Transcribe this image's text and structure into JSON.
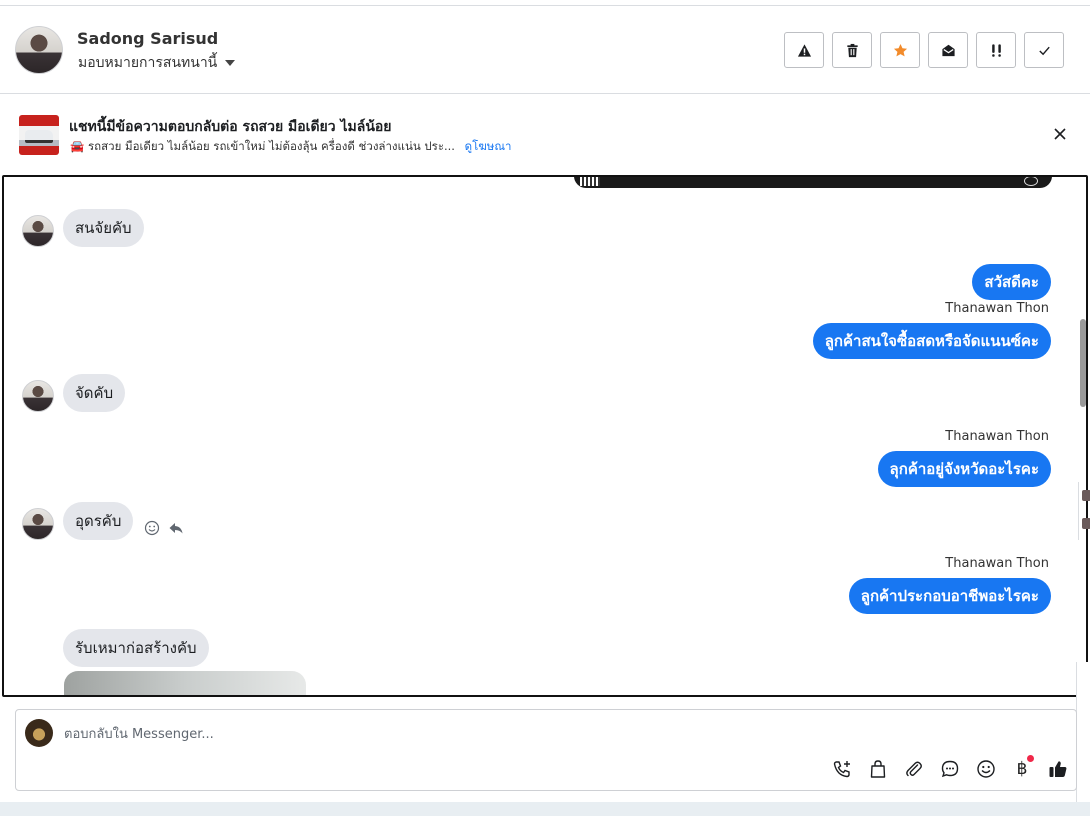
{
  "header": {
    "contact_name": "Sadong Sarisud",
    "assign_label": "มอบหมายการสนทนานี้",
    "actions": [
      {
        "name": "report-spam-button",
        "icon": "warning-icon"
      },
      {
        "name": "delete-button",
        "icon": "trash-icon"
      },
      {
        "name": "star-button",
        "icon": "star-icon",
        "color": "#f28b2b"
      },
      {
        "name": "mark-unread-button",
        "icon": "envelope-open-icon"
      },
      {
        "name": "follow-up-button",
        "icon": "double-exclamation-icon"
      },
      {
        "name": "mark-done-button",
        "icon": "check-icon"
      }
    ]
  },
  "ad_banner": {
    "title": "แชทนี้มีข้อความตอบกลับต่อ รถสวย มือเดียว ไมล์น้อย",
    "subtitle": "🚘 รถสวย มือเดียว ไมล์น้อย รถเข้าใหม่ ไม่ต้องลุ้น ครื่องดี ช่วงล่างแน่น ประ...",
    "link": "ดูโฆษณา"
  },
  "messages": [
    {
      "direction": "in",
      "text": "สนจัยคับ"
    },
    {
      "direction": "out",
      "text": "สวัสดีคะ"
    },
    {
      "direction": "out",
      "sender": "Thanawan Thon",
      "text": "ลูกค้าสนใจซื้อสดหรือจัดแนนซ์คะ"
    },
    {
      "direction": "in",
      "text": "จัดคับ"
    },
    {
      "direction": "out",
      "sender": "Thanawan Thon",
      "text": "ลุกค้าอยู่จังหวัดอะไรคะ"
    },
    {
      "direction": "in",
      "text": "อุดรคับ"
    },
    {
      "direction": "out",
      "sender": "Thanawan Thon",
      "text": "ลูกค้าประกอบอาชีพอะไรคะ"
    },
    {
      "direction": "in",
      "text": "รับเหมาก่อสร้างคับ"
    }
  ],
  "composer": {
    "placeholder": "ตอบกลับใน Messenger...",
    "tools": [
      "phone-add-icon",
      "shopping-bag-icon",
      "paperclip-icon",
      "chat-bubble-icon",
      "emoji-icon",
      "baht-icon",
      "thumbs-up-icon"
    ],
    "baht_symbol": "฿"
  },
  "colors": {
    "accent": "#1877f2",
    "incoming_bubble": "#e4e6eb",
    "notification_dot": "#f02849"
  }
}
